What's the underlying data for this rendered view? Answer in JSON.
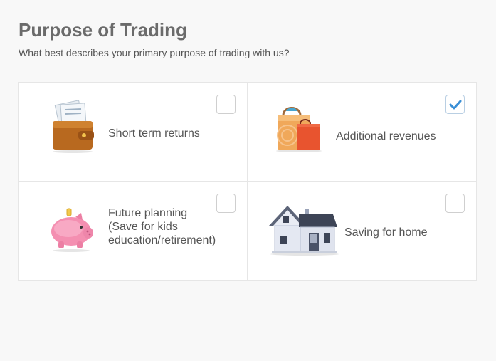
{
  "header": {
    "title": "Purpose of Trading",
    "subtitle": "What best describes your primary purpose of trading with us?"
  },
  "options": [
    {
      "label": "Short term returns",
      "icon": "wallet-icon",
      "checked": false
    },
    {
      "label": "Additional revenues",
      "icon": "shopping-bags-icon",
      "checked": true
    },
    {
      "label_lines": [
        "Future planning",
        "(Save for kids",
        "education/retirement)"
      ],
      "icon": "piggy-bank-icon",
      "checked": false
    },
    {
      "label": "Saving for home",
      "icon": "house-icon",
      "checked": false
    }
  ],
  "colors": {
    "check_mark": "#3a8fd6",
    "title": "#6b6b6b",
    "border": "#e6e6e6"
  }
}
